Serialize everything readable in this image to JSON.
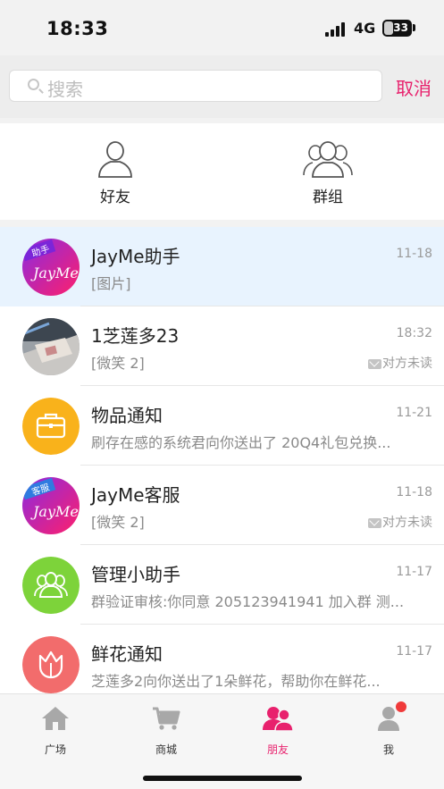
{
  "status_bar": {
    "time": "18:33",
    "network": "4G",
    "battery": "33",
    "battery_fraction": 0.33
  },
  "search": {
    "placeholder": "搜索",
    "cancel_label": "取消"
  },
  "shortcuts": [
    {
      "label": "好友",
      "icon": "person-icon"
    },
    {
      "label": "群组",
      "icon": "group-icon"
    }
  ],
  "conversations": [
    {
      "name": "JayMe助手",
      "preview": "[图片]",
      "time": "11-18",
      "read_status": "",
      "avatar": "jayme-assistant-avatar",
      "avatar_badge": "助手",
      "avatar_text": "JayMe",
      "pinned": true
    },
    {
      "name": "1芝莲多23",
      "preview": "[微笑 2]",
      "time": "18:32",
      "read_status": "对方未读",
      "avatar": "photo-avatar",
      "pinned": false
    },
    {
      "name": "物品通知",
      "preview": "刷存在感的系统君向你送出了 20Q4礼包兑换...",
      "time": "11-21",
      "read_status": "",
      "avatar": "briefcase-icon",
      "pinned": false
    },
    {
      "name": "JayMe客服",
      "preview": "[微笑 2]",
      "time": "11-18",
      "read_status": "对方未读",
      "avatar": "jayme-service-avatar",
      "avatar_badge": "客服",
      "avatar_text": "JayMe",
      "pinned": false
    },
    {
      "name": "管理小助手",
      "preview": "群验证审核:你同意 205123941941 加入群 测...",
      "time": "11-17",
      "read_status": "",
      "avatar": "group-admin-icon",
      "pinned": false
    },
    {
      "name": "鲜花通知",
      "preview": "芝莲多2向你送出了1朵鲜花，帮助你在鲜花...",
      "time": "11-17",
      "read_status": "",
      "avatar": "flower-icon",
      "pinned": false
    }
  ],
  "tabbar": [
    {
      "label": "广场",
      "icon": "home-icon",
      "active": false,
      "badge": false
    },
    {
      "label": "商城",
      "icon": "cart-icon",
      "active": false,
      "badge": false
    },
    {
      "label": "朋友",
      "icon": "friends-icon",
      "active": true,
      "badge": false
    },
    {
      "label": "我",
      "icon": "profile-icon",
      "active": false,
      "badge": true
    }
  ],
  "colors": {
    "accent": "#e8216d",
    "pinned_row": "#e8f3fe",
    "notification_orange": "#f9b21b",
    "admin_green": "#7dd33a",
    "flower_red": "#f26c6c",
    "badge_red": "#f03a3a"
  }
}
